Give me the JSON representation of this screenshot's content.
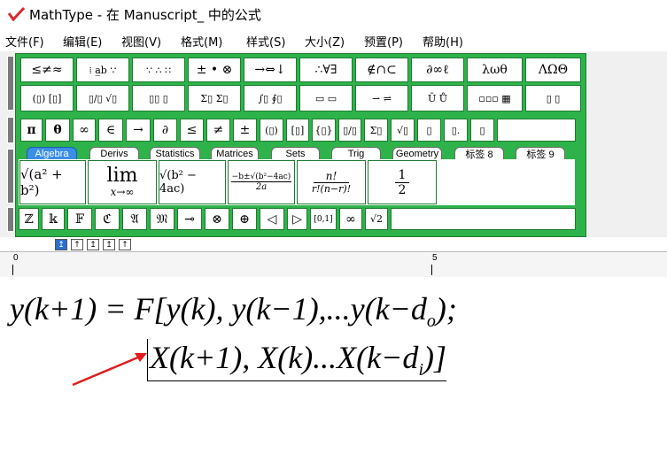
{
  "window": {
    "title": "MathType - 在 Manuscript_ 中的公式"
  },
  "menu": [
    "文件(F)",
    "编辑(E)",
    "视图(V)",
    "格式(M)",
    "样式(S)",
    "大小(Z)",
    "预置(P)",
    "帮助(H)"
  ],
  "palette_row1": [
    "≤≠≈",
    "⁞ a̲b ∵",
    "∵ ∴ ∷",
    "± • ⊗",
    "→⇔↓",
    "∴∀∃",
    "∉∩⊂",
    "∂∞ℓ",
    "λωθ",
    "ΛΩΘ"
  ],
  "palette_row2": [
    "(▯) [▯]",
    "▯/▯ √▯",
    "▯▯ ▯",
    "Σ▯ Σ▯",
    "∫▯ ∮▯",
    "▭ ▭",
    "⇀ ⇌",
    "Ū Ů",
    "▫▫▫ ▦",
    "▯ ▯"
  ],
  "symbol_row": [
    "π",
    "θ",
    "∞",
    "∈",
    "→",
    "∂",
    "≤",
    "≠",
    "±",
    "(▯)",
    "[▯]",
    "{▯}",
    "▯/▯",
    "Σ▯",
    "√▯",
    "▯",
    "▯.",
    "▯"
  ],
  "tabs": [
    "Algebra",
    "Derivs",
    "Statistics",
    "Matrices",
    "Sets",
    "Trig",
    "Geometry",
    "标签 8",
    "标签 9"
  ],
  "templates": {
    "t1": "√(a² + b²)",
    "t2_top": "lim",
    "t2_bottom": "x→∞",
    "t3": "√(b² − 4ac)",
    "t4_num": "−b±√(b²−4ac)",
    "t4_den": "2a",
    "t5_num": "n!",
    "t5_den": "r!(n−r)!",
    "t6_num": "1",
    "t6_den": "2"
  },
  "bottom_row": [
    "ℤ",
    "𝕜",
    "𝔽",
    "ℭ",
    "𝔄",
    "𝔐",
    "⊸",
    "⊗",
    "⊕",
    "◁",
    "▷",
    "[0,1]",
    "∞",
    "√2"
  ],
  "nav_buttons": [
    "↥",
    "↑",
    "↥",
    "↥",
    "↑"
  ],
  "ruler": {
    "labels": [
      "0",
      "5"
    ]
  },
  "equation": {
    "line1": "y(k+1) = F[y(k), y(k−1),...y(k−d",
    "line1_sub": "o",
    "line1_end": ");",
    "line2": "X(k+1), X(k)...X(k−d",
    "line2_sub": "i",
    "line2_end": ")]"
  },
  "colors": {
    "palette_green": "#2eb34a",
    "arrow_red": "#e21c1c",
    "tab_active": "#3a8ee6"
  }
}
